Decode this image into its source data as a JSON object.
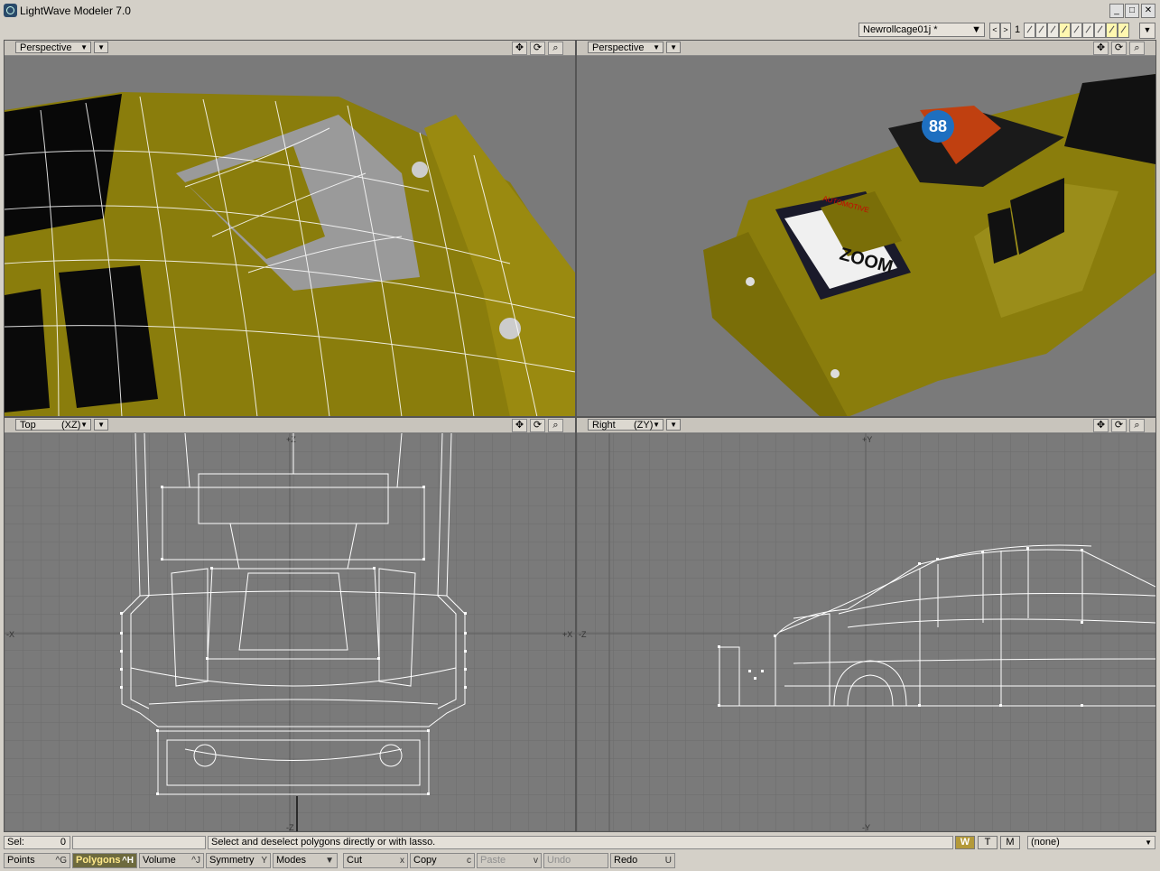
{
  "app": {
    "title": "LightWave Modeler 7.0"
  },
  "window_buttons": [
    "_",
    "□",
    "✕"
  ],
  "toolbar": {
    "object_name": "Newrollcage01j *",
    "layer_number": "1",
    "prev_label": "<",
    "next_label": ">"
  },
  "viewports": [
    {
      "name": "Perspective",
      "kind": "perspective-wire"
    },
    {
      "name": "Perspective",
      "kind": "perspective-texture"
    },
    {
      "name": "Top",
      "axes": "(XZ)",
      "kind": "ortho-top",
      "axis_labels": {
        "top": "+Z",
        "bottom": "-Z",
        "left": "-X",
        "right": "+X"
      }
    },
    {
      "name": "Right",
      "axes": "(ZY)",
      "kind": "ortho-right",
      "axis_labels": {
        "top": "+Y",
        "bottom": "-Y",
        "left": "-Z",
        "right": ""
      }
    }
  ],
  "viewport_icons": [
    "move-view-icon",
    "rotate-view-icon",
    "zoom-view-icon"
  ],
  "decal": {
    "number": "88",
    "text": "ZOOM",
    "small": "AUTOMOTIVE"
  },
  "status": {
    "sel_label": "Sel:",
    "sel_value": "0",
    "message": "Select and deselect polygons directly or with lasso.",
    "wtm": [
      "W",
      "T",
      "M"
    ],
    "surface": "(none)"
  },
  "modebar": [
    {
      "label": "Points",
      "key": "^G",
      "state": "normal"
    },
    {
      "label": "Polygons",
      "key": "^H",
      "state": "active"
    },
    {
      "label": "Volume",
      "key": "^J",
      "state": "normal"
    },
    {
      "label": "Symmetry",
      "key": "Y",
      "state": "normal"
    },
    {
      "label": "Modes",
      "key": "▼",
      "state": "normal"
    },
    {
      "label": "Cut",
      "key": "x",
      "state": "normal"
    },
    {
      "label": "Copy",
      "key": "c",
      "state": "normal"
    },
    {
      "label": "Paste",
      "key": "v",
      "state": "disabled"
    },
    {
      "label": "Undo",
      "key": "",
      "state": "disabled"
    },
    {
      "label": "Redo",
      "key": "U",
      "state": "normal"
    }
  ],
  "colors": {
    "car": "#8a7d0c",
    "viewport_bg": "#7a7a7a",
    "grid": "#6d6d6d",
    "wire": "#ffffff",
    "active_mode": "#6d6a3e"
  }
}
